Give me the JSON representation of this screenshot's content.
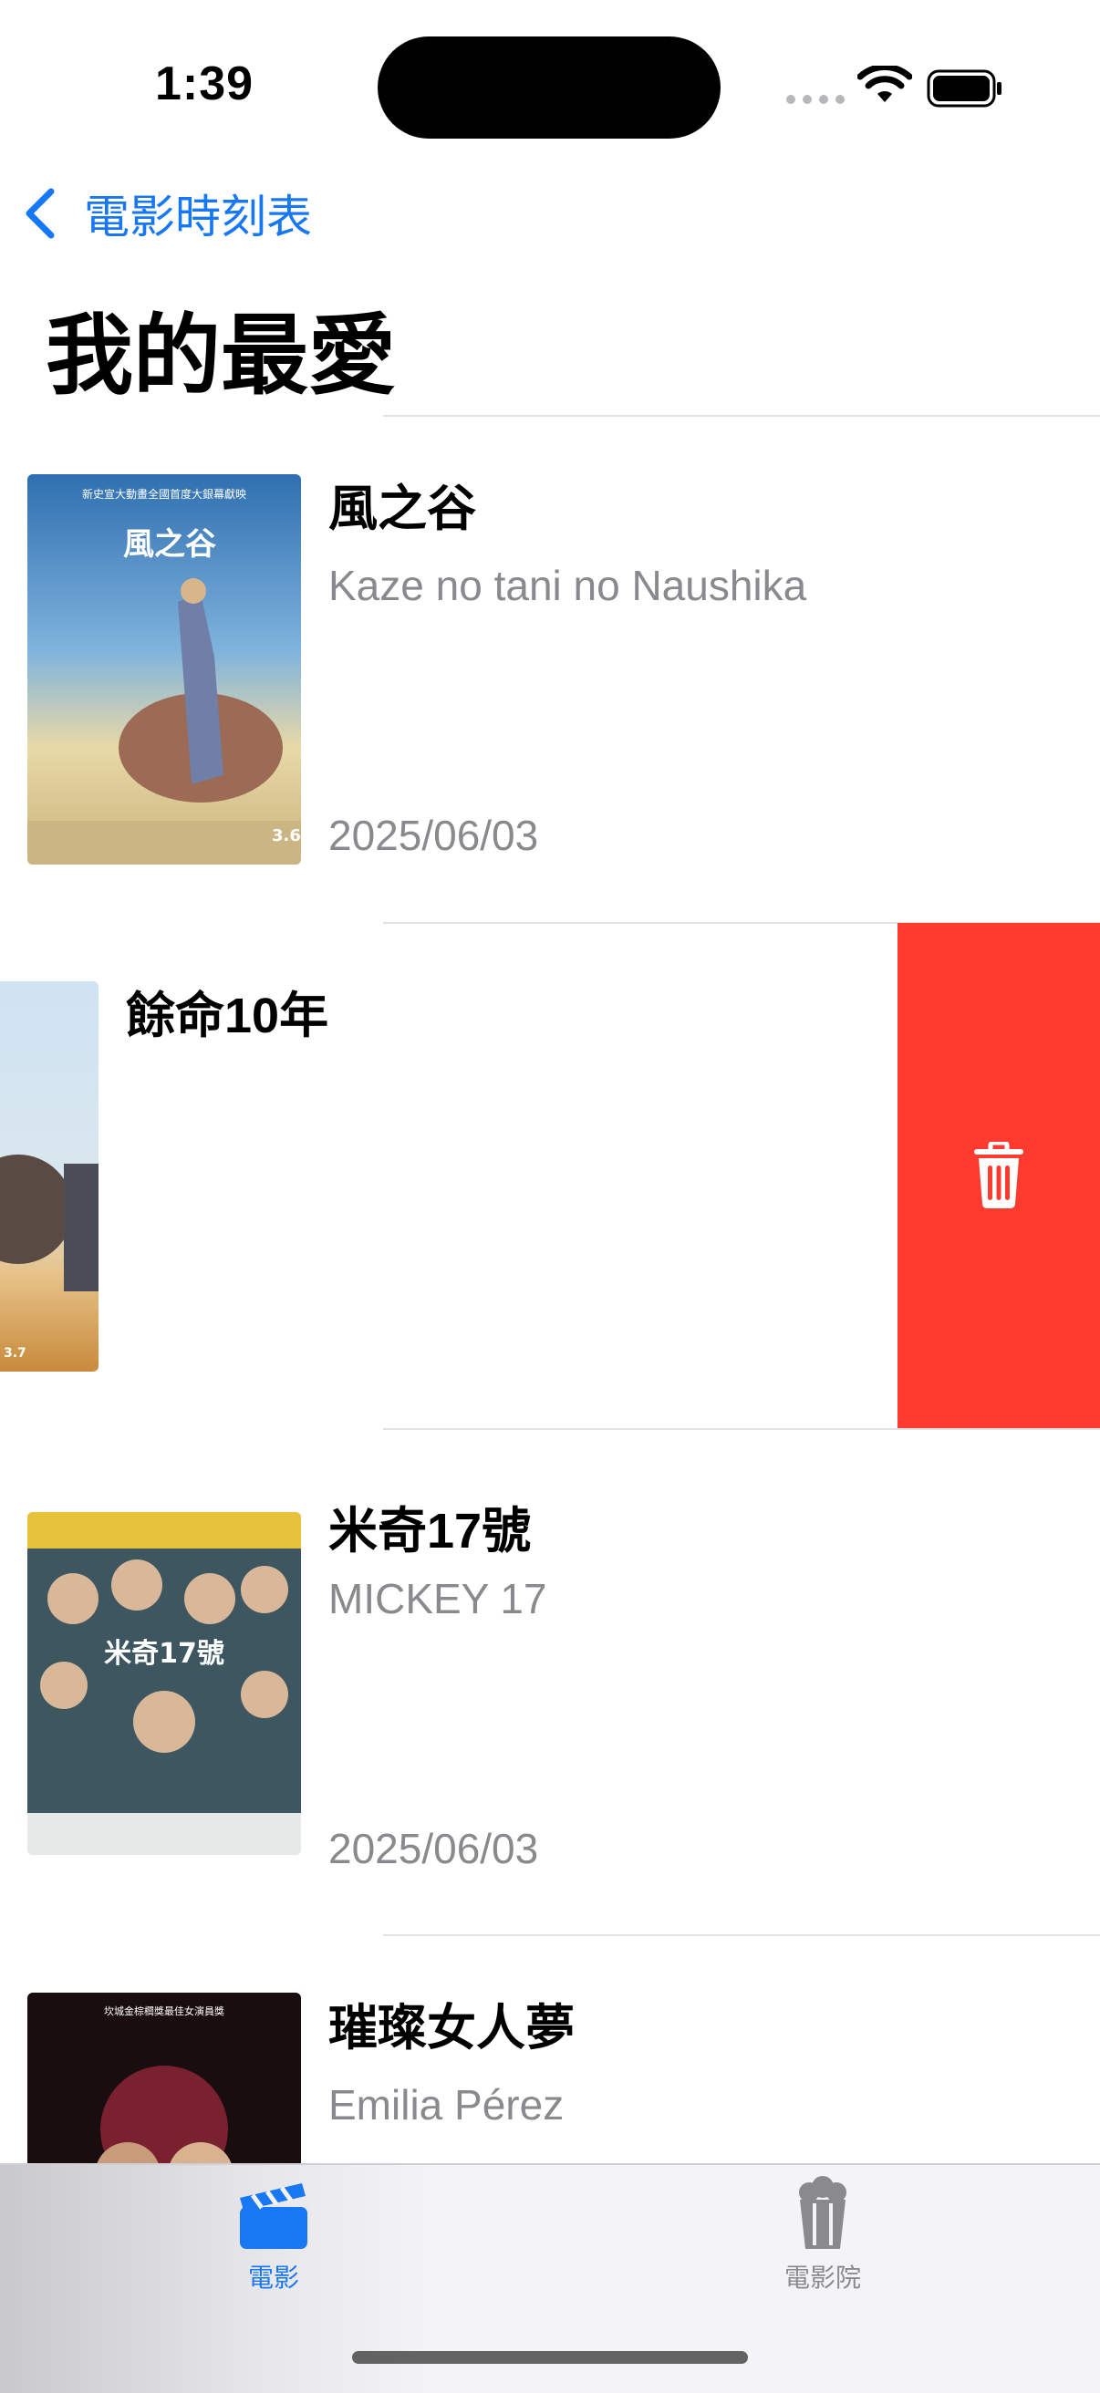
{
  "status_bar": {
    "time": "1:39"
  },
  "nav": {
    "back_label": "電影時刻表",
    "title": "我的最愛"
  },
  "movies": [
    {
      "title": "風之谷",
      "subtitle": "Kaze no tani no Naushika",
      "date": "2025/06/03"
    },
    {
      "title": "餘命10年",
      "subtitle": "",
      "date": ""
    },
    {
      "title": "米奇17號",
      "subtitle": "MICKEY 17",
      "date": "2025/06/03"
    },
    {
      "title": "璀璨女人夢",
      "subtitle": "Emilia Pérez",
      "date": ""
    }
  ],
  "tab_bar": {
    "tabs": [
      {
        "label": "電影",
        "icon": "clapperboard-icon",
        "selected": true
      },
      {
        "label": "電影院",
        "icon": "popcorn-icon",
        "selected": false
      }
    ]
  },
  "colors": {
    "accent": "#1877f2",
    "delete": "#ff3b30",
    "secondary_text": "#8a8a8e"
  },
  "delete_action": {
    "icon": "trash-icon"
  }
}
